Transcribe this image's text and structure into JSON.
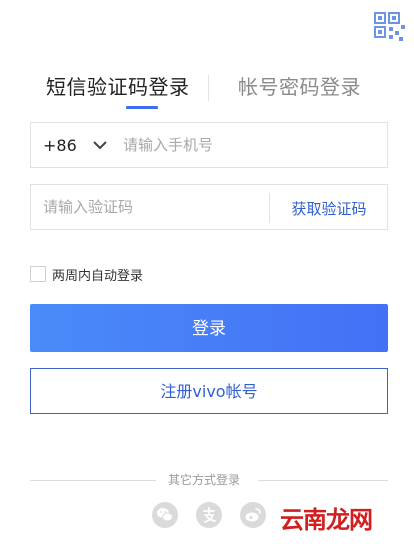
{
  "tabs": {
    "sms_login": "短信验证码登录",
    "account_login": "帐号密码登录"
  },
  "phone": {
    "country_code": "+86",
    "placeholder": "请输入手机号"
  },
  "code": {
    "placeholder": "请输入验证码",
    "get_code_label": "获取验证码"
  },
  "remember": {
    "label": "两周内自动登录",
    "checked": false
  },
  "buttons": {
    "login_label": "登录",
    "register_label": "注册vivo帐号"
  },
  "other_login": {
    "label": "其它方式登录",
    "icons": [
      "wechat-icon",
      "alipay-icon",
      "weibo-icon"
    ]
  },
  "watermark": "云南龙网",
  "colors": {
    "accent": "#4470f6",
    "link": "#2f5fd0",
    "watermark": "#d11e1e"
  }
}
